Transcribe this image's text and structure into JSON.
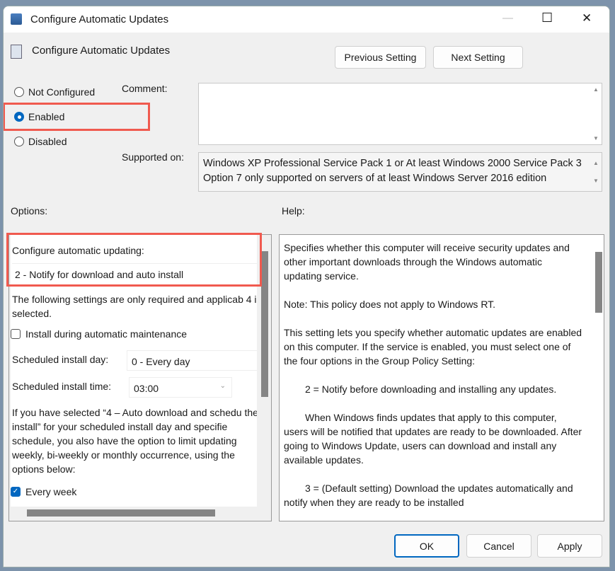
{
  "window": {
    "title": "Configure Automatic Updates",
    "minimize": "—",
    "maximize": "☐",
    "close": "✕"
  },
  "header": {
    "title": "Configure Automatic Updates",
    "previous": "Previous Setting",
    "next": "Next Setting"
  },
  "state": {
    "options": [
      "Not Configured",
      "Enabled",
      "Disabled"
    ],
    "selected": "Enabled"
  },
  "comment": {
    "label": "Comment:",
    "value": ""
  },
  "supported": {
    "label": "Supported on:",
    "lines": [
      "Windows XP Professional Service Pack 1 or At least Windows 2000 Service Pack 3",
      "Option 7 only supported on servers of at least Windows Server 2016 edition"
    ]
  },
  "options": {
    "label": "Options:",
    "configure_label": "Configure automatic updating:",
    "configure_value": "2 - Notify for download and auto install",
    "note": "The following settings are only required and applicab 4 is selected.",
    "install_maintenance": "Install during automatic maintenance",
    "install_maintenance_checked": false,
    "day_label": "Scheduled install day:",
    "day_value": "0 - Every day",
    "time_label": "Scheduled install time:",
    "time_value": "03:00",
    "info": "If you have selected “4 – Auto download and schedu the install” for your scheduled install day and specifie schedule, you also have the option to limit updating weekly, bi-weekly or monthly occurrence, using the options below:",
    "every_week": "Every week",
    "every_week_checked": true
  },
  "help": {
    "label": "Help:",
    "paragraphs": [
      "Specifies whether this computer will receive security updates and other important downloads through the Windows automatic updating service.",
      "Note: This policy does not apply to Windows RT.",
      "This setting lets you specify whether automatic updates are enabled on this computer. If the service is enabled, you must select one of the four options in the Group Policy Setting:",
      "2 = Notify before downloading and installing any updates.",
      "When Windows finds updates that apply to this computer, users will be notified that updates are ready to be downloaded. After going to Windows Update, users can download and install any available updates.",
      "3 = (Default setting) Download the updates automatically and notify when they are ready to be installed"
    ]
  },
  "footer": {
    "ok": "OK",
    "cancel": "Cancel",
    "apply": "Apply"
  }
}
